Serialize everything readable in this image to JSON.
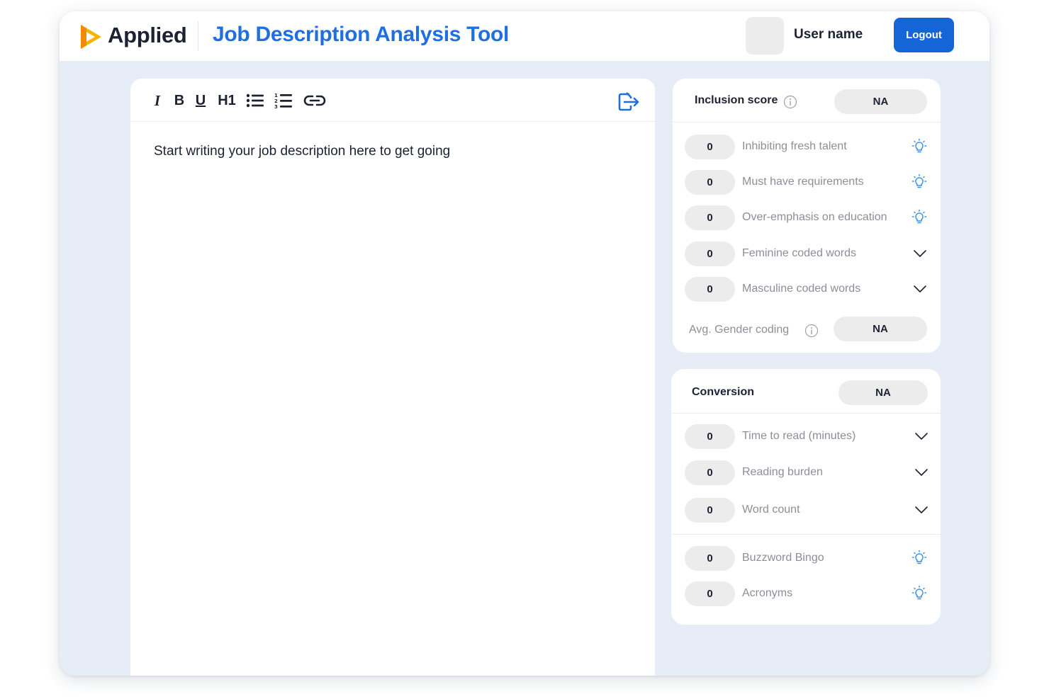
{
  "header": {
    "brand": "Applied",
    "title": "Job Description Analysis Tool",
    "user_name": "User name",
    "logout_label": "Logout",
    "brand_color": "#1f6fe0",
    "logo_colors": [
      "#f4b400",
      "#f08a00"
    ]
  },
  "editor": {
    "toolbar": [
      {
        "name": "italic",
        "label": "I"
      },
      {
        "name": "bold",
        "label": "B"
      },
      {
        "name": "underline",
        "label": "U"
      },
      {
        "name": "heading-1",
        "label": "H1"
      },
      {
        "name": "bullet-list",
        "icon": "bullet-list-icon"
      },
      {
        "name": "numbered-list",
        "icon": "numbered-list-icon"
      },
      {
        "name": "link",
        "icon": "link-icon"
      }
    ],
    "export_icon": "export-icon",
    "placeholder": "Start writing your job description here to get going"
  },
  "inclusion": {
    "label": "Inclusion score",
    "score": "NA",
    "rows": [
      {
        "count": "0",
        "label": "Inhibiting fresh talent",
        "icon": "lightbulb-icon"
      },
      {
        "count": "0",
        "label": "Must have requirements",
        "icon": "lightbulb-icon"
      },
      {
        "count": "0",
        "label": "Over-emphasis on education",
        "icon": "lightbulb-icon"
      },
      {
        "count": "0",
        "label": "Feminine coded words",
        "icon": "chevron-down-icon"
      },
      {
        "count": "0",
        "label": "Masculine coded words",
        "icon": "chevron-down-icon"
      }
    ],
    "avg_label": "Avg. Gender coding",
    "avg_value": "NA"
  },
  "conversion": {
    "label": "Conversion",
    "score": "NA",
    "rows": [
      {
        "count": "0",
        "label": "Time to read (minutes)",
        "icon": "chevron-down-icon"
      },
      {
        "count": "0",
        "label": "Reading burden",
        "icon": "chevron-down-icon"
      },
      {
        "count": "0",
        "label": "Word count",
        "icon": "chevron-down-icon"
      },
      {
        "count": "0",
        "label": "Buzzword Bingo",
        "icon": "lightbulb-icon"
      },
      {
        "count": "0",
        "label": "Acronyms",
        "icon": "lightbulb-icon"
      }
    ]
  },
  "colors": {
    "accent": "#1565d8",
    "icon_blue": "#3b8ee8",
    "background": "#e6edf7",
    "pill": "#ececec"
  }
}
